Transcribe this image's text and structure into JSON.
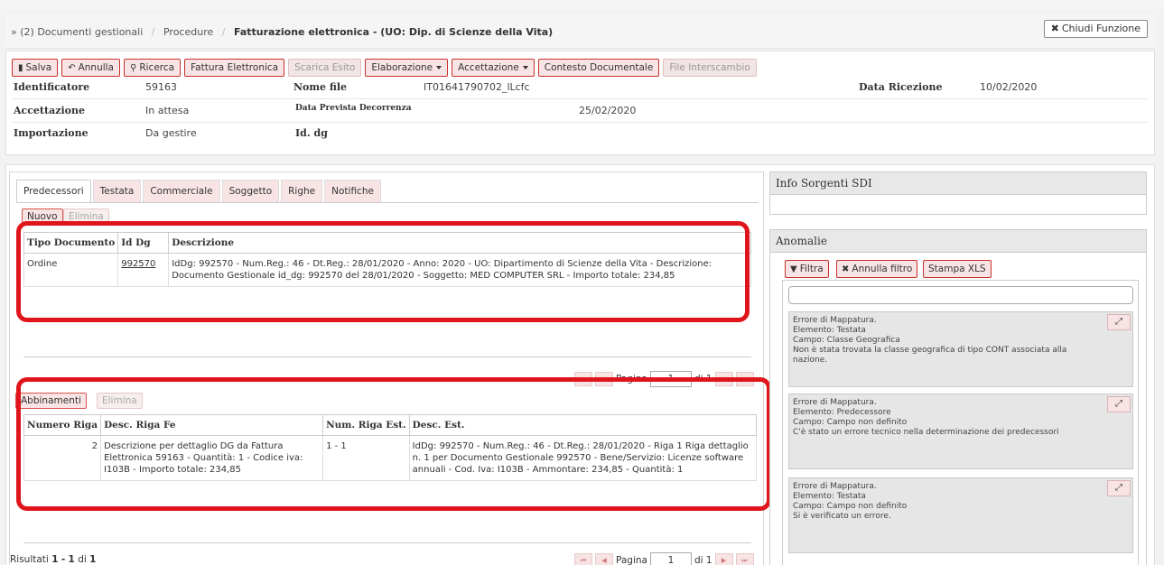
{
  "breadcrumb": {
    "prefix": "»",
    "items": [
      "(2) Documenti gestionali",
      "Procedure"
    ],
    "current": "Fatturazione elettronica - (UO: Dip. di Scienze della Vita)"
  },
  "close_button": {
    "label": "Chiudi Funzione"
  },
  "toolbar": {
    "salva": "Salva",
    "annulla": "Annulla",
    "ricerca": "Ricerca",
    "fattura": "Fattura Elettronica",
    "scarica": "Scarica Esito",
    "elaborazione": "Elaborazione",
    "accettazione": "Accettazione",
    "contesto": "Contesto Documentale",
    "interscambio": "File Interscambio"
  },
  "fields": {
    "identificatore_label": "Identificatore",
    "identificatore_value": "59163",
    "nome_file_label": "Nome file",
    "nome_file_value": "IT01641790702_lLcfc",
    "data_ricezione_label": "Data Ricezione",
    "data_ricezione_value": "10/02/2020",
    "accettazione_label": "Accettazione",
    "accettazione_value": "In attesa",
    "data_prevista_label": "Data Prevista Decorrenza",
    "data_prevista_value": "25/02/2020",
    "importazione_label": "Importazione",
    "importazione_value": "Da gestire",
    "id_dg_label": "Id. dg"
  },
  "tabs": [
    "Predecessori",
    "Testata",
    "Commerciale",
    "Soggetto",
    "Righe",
    "Notifiche"
  ],
  "predecessori": {
    "nuovo": "Nuovo",
    "elimina": "Elimina",
    "columns": [
      "Tipo Documento",
      "Id Dg",
      "Descrizione"
    ],
    "rows": [
      {
        "tipo": "Ordine",
        "id_dg": "992570",
        "descrizione": "IdDg: 992570 - Num.Reg.: 46 - Dt.Reg.: 28/01/2020 - Anno: 2020 - UO: Dipartimento di Scienze della Vita - Descrizione: Documento Gestionale id_dg: 992570 del 28/01/2020 - Soggetto: MED COMPUTER SRL - Importo totale: 234,85"
      }
    ]
  },
  "pager_top": {
    "page_label": "Pagina",
    "page_value": "1",
    "of_label": "di 1"
  },
  "abbinamenti": {
    "abbinamenti": "Abbinamenti",
    "elimina": "Elimina",
    "columns": [
      "Numero Riga",
      "Desc. Riga Fe",
      "Num. Riga Est.",
      "Desc. Est."
    ],
    "rows": [
      {
        "numero": "2",
        "desc_fe": "Descrizione per dettaglio DG da Fattura Elettronica 59163 - Quantità: 1 - Codice iva: I103B - Importo totale: 234,85",
        "num_est": "1 - 1",
        "desc_est": "IdDg: 992570 - Num.Reg.: 46 - Dt.Reg.: 28/01/2020 - Riga 1 Riga dettaglio n. 1 per Documento Gestionale 992570 - Bene/Servizio: Licenze software annuali - Cod. Iva: I103B - Ammontare: 234,85 - Quantità: 1"
      }
    ]
  },
  "results_bottom": {
    "prefix": "Risultati",
    "from": "1",
    "dash": "-",
    "to": "1",
    "di": "di",
    "total": "1"
  },
  "pager_bottom": {
    "page_label": "Pagina",
    "page_value": "1",
    "of_label": "di 1"
  },
  "sdi": {
    "title": "Info Sorgenti SDI"
  },
  "anomalie": {
    "title": "Anomalie",
    "filtra": "Filtra",
    "annulla_filtro": "Annulla filtro",
    "stampa": "Stampa XLS",
    "errors": [
      [
        "Errore di Mappatura.",
        "Elemento: Testata",
        "Campo: Classe Geografica",
        "Non è stata trovata la classe geografica di tipo CONT associata alla nazione."
      ],
      [
        "Errore di Mappatura.",
        "Elemento: Predecessore",
        "Campo: Campo non definito",
        "C'è stato un errore tecnico nella determinazione dei predecessori"
      ],
      [
        "Errore di Mappatura.",
        "Elemento: Testata",
        "Campo: Campo non definito",
        "Si è verificato un errore."
      ]
    ]
  },
  "colors": {
    "accent_red": "#e0151b",
    "button_bg": "#f8e4e4"
  }
}
